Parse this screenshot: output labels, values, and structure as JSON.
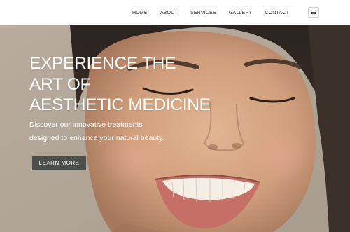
{
  "nav": {
    "items": [
      "HOME",
      "ABOUT",
      "SERVICES",
      "GALLERY",
      "CONTACT"
    ],
    "menu_icon": "hamburger-icon"
  },
  "hero": {
    "title_lines": [
      "EXPERIENCE THE",
      "ART OF",
      "AESTHETIC MEDICINE"
    ],
    "subtitle_lines": [
      "Discover our innovative treatments",
      "designed to enhance your natural beauty."
    ],
    "cta_label": "LEARN MORE",
    "image": "smiling-woman-closed-eyes-portrait"
  },
  "colors": {
    "header_bg": "#ffffff",
    "hero_bg": "#b7ac9f",
    "text_light": "#ffffff",
    "nav_text": "#2b2b2b",
    "cta_bg": "#4b4f4c"
  }
}
